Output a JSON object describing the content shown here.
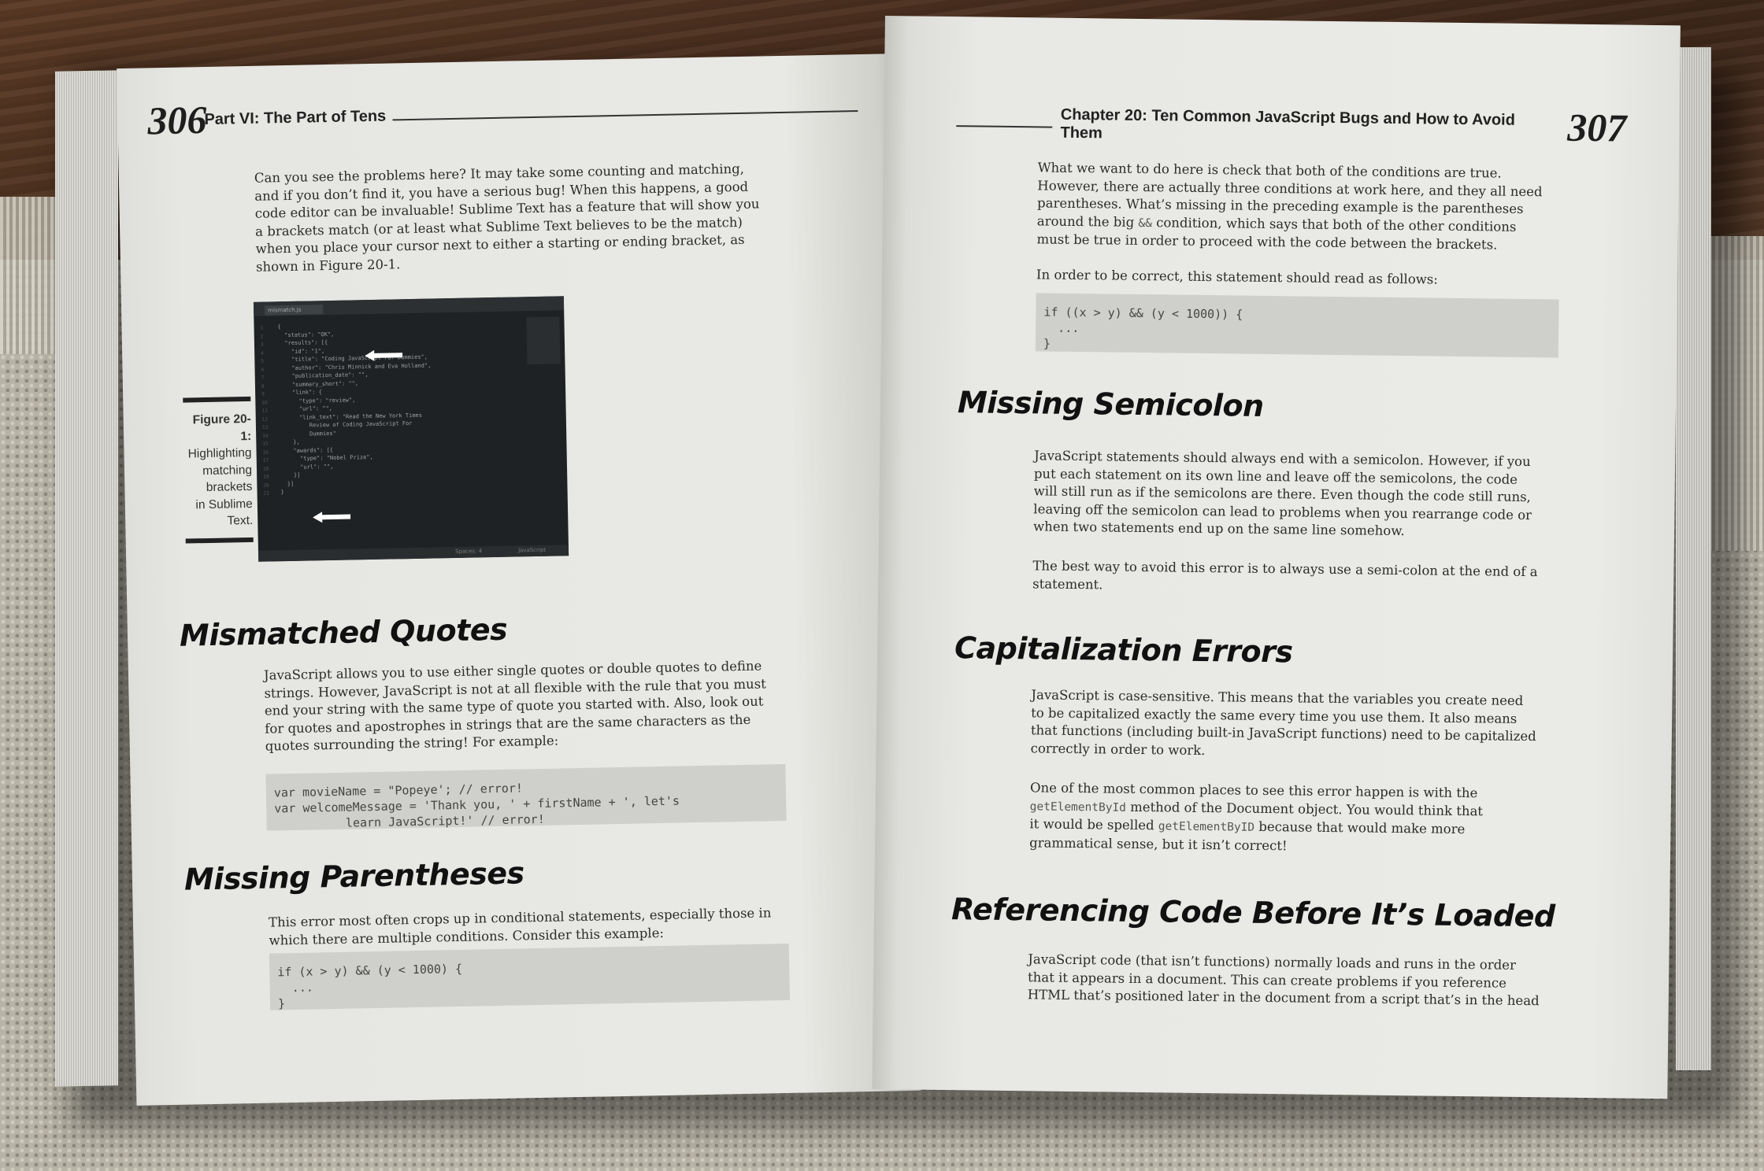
{
  "left_page": {
    "page_number": "306",
    "running_head": "Part VI: The Part of Tens",
    "intro_lines": [
      "Can you see the problems here? It may take some counting and matching,",
      "and if you don’t find it, you have a serious bug! When this happens, a good",
      "code editor can be invaluable! Sublime Text has a feature that will show you",
      "a brackets match (or at least what Sublime Text believes to be the match)",
      "when you place your cursor next to either a starting or ending bracket, as",
      "shown in Figure 20-1."
    ],
    "figure": {
      "label": "Figure 20-1:",
      "caption_lines": [
        "Highlighting",
        "matching",
        "brackets",
        "in Sublime",
        "Text."
      ],
      "tab_label": "mismatch.js",
      "code_lines": [
        "{",
        "  \"status\": \"OK\",",
        "  \"results\": [{",
        "    \"id\": \"1\",",
        "    \"title\": \"Coding JavaScript For Dummies\",",
        "    \"author\": \"Chris Minnick and Eva Holland\",",
        "    \"publication_date\": \"\",",
        "    \"summary_short\": \"\",",
        "    \"link\": {",
        "      \"type\": \"review\",",
        "      \"url\": \"\",",
        "      \"link_text\": \"Read the New York Times",
        "         Review of Coding JavaScript For",
        "         Dummies\"",
        "    },",
        "    \"awards\": [{",
        "      \"type\": \"Nobel Prize\",",
        "      \"url\": \"\",",
        "    }]",
        "  }]",
        "}"
      ],
      "status_left": "Spaces: 4",
      "status_right": "JavaScript"
    },
    "sections": {
      "mismatched_quotes": {
        "heading": "Mismatched Quotes",
        "lines": [
          "JavaScript allows you to use either single quotes or double quotes to define",
          "strings. However, JavaScript is not at all flexible with the rule that you must",
          "end your string with the same type of quote you started with. Also, look out",
          "for quotes and apostrophes in strings that are the same characters as the",
          "quotes surrounding the string! For example:"
        ],
        "code": "var movieName = \"Popeye'; // error!\nvar welcomeMessage = 'Thank you, ' + firstName + ', let's\n          learn JavaScript!' // error!"
      },
      "missing_parentheses": {
        "heading": "Missing Parentheses",
        "lines": [
          "This error most often crops up in conditional statements, especially those in",
          "which there are multiple conditions. Consider this example:"
        ],
        "code": "if (x > y) && (y < 1000) {\n  ...\n}"
      }
    }
  },
  "right_page": {
    "page_number": "307",
    "running_head": "Chapter 20: Ten Common JavaScript Bugs and How to Avoid Them",
    "intro_lines": [
      "What we want to do here is check that both of the conditions are true.",
      "However, there are actually three conditions at work here, and they all need",
      "parentheses. What’s missing in the preceding example is the parentheses",
      "around the big",
      "condition, which says that both of the other conditions",
      "must be true in order to proceed with the code between the brackets."
    ],
    "intro_inline_code": "&&",
    "correct_line": "In order to be correct, this statement should read as follows:",
    "correct_code": "if ((x > y) && (y < 1000)) {\n  ...\n}",
    "sections": {
      "missing_semicolon": {
        "heading": "Missing Semicolon",
        "lines": [
          "JavaScript statements should always end with a semicolon. However, if you",
          "put each statement on its own line and leave off the semicolons, the code",
          "will still run as if the semicolons are there. Even though the code still runs,",
          "leaving off the semicolon can lead to problems when you rearrange code or",
          "when two statements end up on the same line somehow."
        ],
        "lines2": [
          "The best way to avoid this error is to always use a semi-colon at the end of a",
          "statement."
        ]
      },
      "capitalization_errors": {
        "heading": "Capitalization Errors",
        "lines": [
          "JavaScript is case-sensitive. This means that the variables you create need",
          "to be capitalized exactly the same every time you use them. It also means",
          "that functions (including built-in JavaScript functions) need to be capitalized",
          "correctly in order to work."
        ],
        "p2_line1": "One of the most common places to see this error happen is with the",
        "p2_code1": "getElementById",
        "p2_line2_rest": "method of the Document object. You would think that",
        "p2_line3_start": "it would be spelled",
        "p2_code2": "getElementByID",
        "p2_line3_rest": "because that would make more",
        "p2_line4": "grammatical sense, but it isn’t correct!"
      },
      "referencing_code": {
        "heading": "Referencing Code Before It’s Loaded",
        "lines": [
          "JavaScript code (that isn’t functions) normally loads and runs in the order",
          "that it appears in a document. This can create problems if you reference",
          "HTML that’s positioned later in the document from a script that’s in the head"
        ]
      }
    }
  },
  "colors": {
    "paper": "#e9e9e5",
    "ink": "#262626",
    "code_bg": "#cfcfcb",
    "editor_bg": "#1f2224"
  },
  "icons": {
    "figure_arrow_top": "arrow-left-icon",
    "figure_arrow_bottom": "arrow-left-icon"
  }
}
